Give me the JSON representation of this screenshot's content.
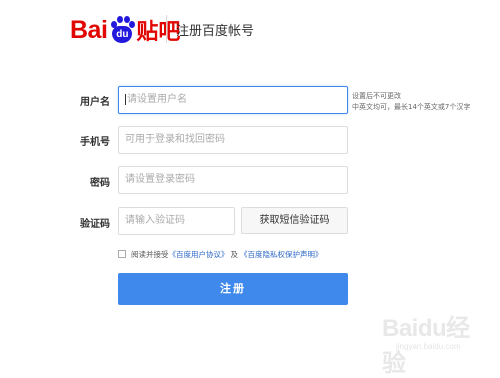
{
  "header": {
    "logo_bai": "Bai",
    "logo_du": "du",
    "logo_tieba": "贴吧",
    "title": "注册百度帐号"
  },
  "form": {
    "username": {
      "label": "用户名",
      "placeholder": "请设置用户名",
      "hint_line1": "设置后不可更改",
      "hint_line2": "中英文均可，最长14个英文或7个汉字"
    },
    "phone": {
      "label": "手机号",
      "placeholder": "可用于登录和找回密码"
    },
    "password": {
      "label": "密码",
      "placeholder": "请设置登录密码"
    },
    "captcha": {
      "label": "验证码",
      "placeholder": "请输入验证码",
      "sms_button": "获取短信验证码"
    },
    "agreement": {
      "prefix": "阅读并接受",
      "user_agreement": "《百度用户协议》",
      "joiner": "及",
      "privacy": "《百度隐私权保护声明》"
    },
    "submit": "注册"
  },
  "watermark": {
    "brand": "Baidu经验",
    "url": "jingyan.baidu.com"
  },
  "colors": {
    "brand_red": "#e10602",
    "brand_blue": "#2319dc",
    "primary": "#3f89ec",
    "link": "#2e68c8"
  }
}
